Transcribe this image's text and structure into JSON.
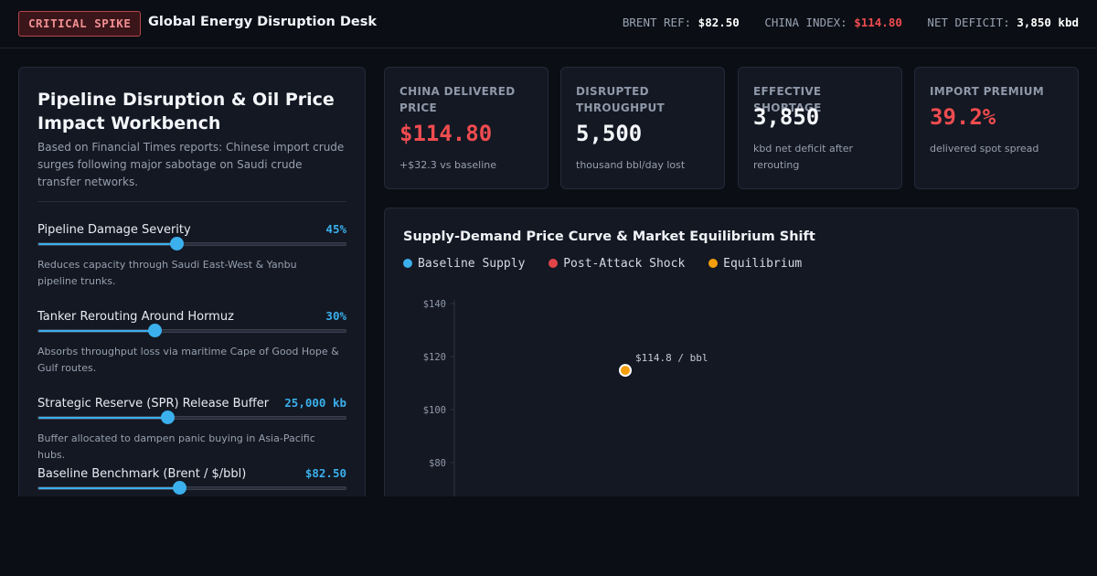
{
  "header": {
    "badge": "CRITICAL SPIKE",
    "title": "Global Energy Disruption Desk",
    "metrics": [
      {
        "label": "BRENT REF:",
        "value": "$82.50",
        "color": "#ffffff"
      },
      {
        "label": "CHINA INDEX:",
        "value": "$114.80",
        "color": "#ef4c4f"
      },
      {
        "label": "NET DEFICIT:",
        "value": "3,850 kbd",
        "color": "#ffffff"
      }
    ]
  },
  "workbench": {
    "title": "Pipeline Disruption & Oil Price Impact Workbench",
    "description": "Based on Financial Times reports: Chinese import crude surges following major sabotage on Saudi crude transfer networks.",
    "controls": [
      {
        "label": "Pipeline Damage Severity",
        "value": "45%",
        "level": 0.45,
        "help": "Reduces capacity through Saudi East-West & Yanbu pipeline trunks."
      },
      {
        "label": "Tanker Rerouting Around Hormuz",
        "value": "30%",
        "level": 0.38,
        "help": "Absorbs throughput loss via maritime Cape of Good Hope & Gulf routes."
      },
      {
        "label": "Strategic Reserve (SPR) Release Buffer",
        "value": "25,000 kb",
        "level": 0.42,
        "help": "Buffer allocated to dampen panic buying in Asia-Pacific hubs."
      },
      {
        "label": "Baseline Benchmark (Brent / $/bbl)",
        "value": "$82.50",
        "level": 0.46,
        "help": ""
      }
    ]
  },
  "kpis": [
    {
      "label": "China Delivered Price",
      "value": "$114.80",
      "sub": "+$32.3 vs baseline",
      "accent": "red"
    },
    {
      "label": "Disrupted Throughput",
      "value": "5,500",
      "sub": "thousand bbl/day lost",
      "accent": "white"
    },
    {
      "label": "Effective Shortage",
      "value": "3,850",
      "sub": "kbd net deficit after rerouting",
      "accent": "white"
    },
    {
      "label": "Import Premium",
      "value": "39.2%",
      "sub": "delivered spot spread",
      "accent": "red"
    }
  ],
  "chart_data": {
    "type": "scatter",
    "title": "Supply-Demand Price Curve & Market Equilibrium Shift",
    "legend": [
      {
        "name": "Baseline Supply",
        "color": "#3bb0ec"
      },
      {
        "name": "Post-Attack Shock",
        "color": "#e24549"
      },
      {
        "name": "Equilibrium",
        "color": "#f59e0b"
      }
    ],
    "yticks": [
      "$140",
      "$120",
      "$100",
      "$80"
    ],
    "ytick_values": [
      140,
      120,
      100,
      80
    ],
    "ylim": [
      80,
      140
    ],
    "points": [
      {
        "series": "Equilibrium",
        "y": 114.8,
        "label": "$114.8 / bbl"
      }
    ],
    "ylabel": "",
    "xlabel": ""
  },
  "colors": {
    "accent": "#3bb0ec",
    "danger": "#ef4c4f",
    "equilibrium": "#f59e0b"
  }
}
